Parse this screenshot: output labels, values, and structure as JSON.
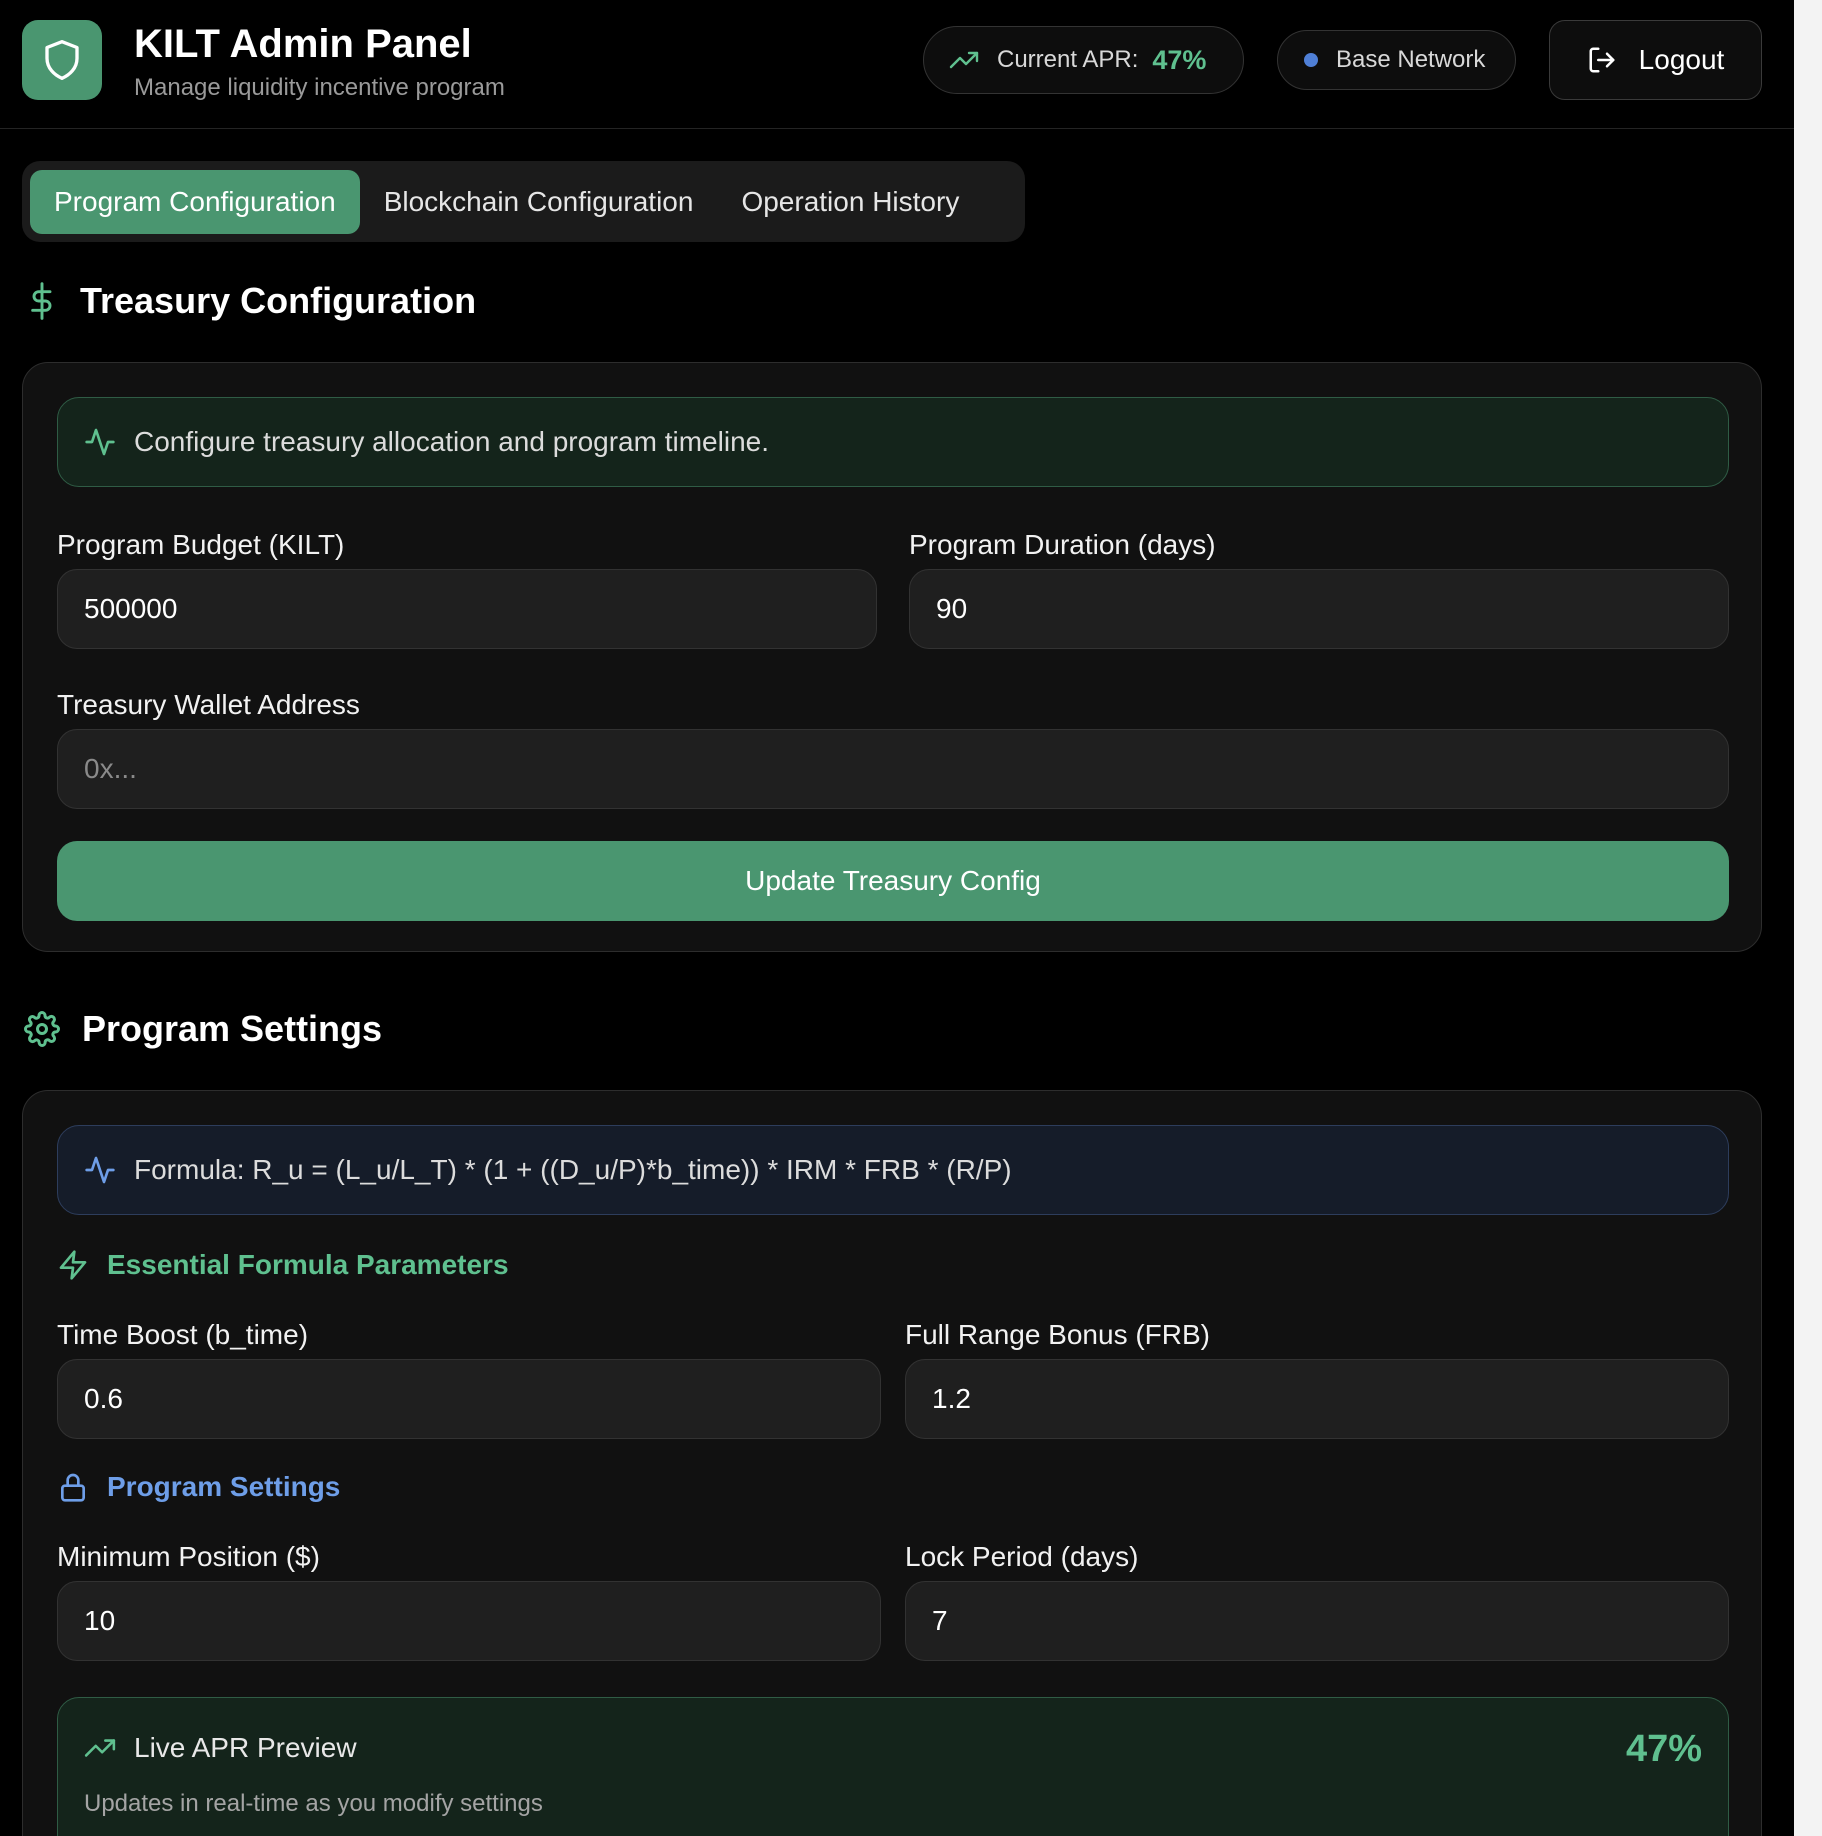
{
  "header": {
    "title": "KILT Admin Panel",
    "subtitle": "Manage liquidity incentive program",
    "apr_label": "Current APR:",
    "apr_value": "47%",
    "network_label": "Base Network",
    "logout_label": "Logout"
  },
  "tabs": [
    {
      "label": "Program Configuration",
      "active": true
    },
    {
      "label": "Blockchain Configuration",
      "active": false
    },
    {
      "label": "Operation History",
      "active": false
    }
  ],
  "treasury": {
    "title": "Treasury Configuration",
    "notice": "Configure treasury allocation and program timeline.",
    "budget_label": "Program Budget (KILT)",
    "budget_value": "500000",
    "duration_label": "Program Duration (days)",
    "duration_value": "90",
    "wallet_label": "Treasury Wallet Address",
    "wallet_placeholder": "0x...",
    "wallet_value": "",
    "update_button": "Update Treasury Config"
  },
  "settings": {
    "title": "Program Settings",
    "formula": "Formula: R_u = (L_u/L_T) * (1 + ((D_u/P)*b_time)) * IRM * FRB * (R/P)",
    "essential_title": "Essential Formula Parameters",
    "time_boost_label": "Time Boost (b_time)",
    "time_boost_value": "0.6",
    "frb_label": "Full Range Bonus (FRB)",
    "frb_value": "1.2",
    "program_settings_sub": "Program Settings",
    "min_position_label": "Minimum Position ($)",
    "min_position_value": "10",
    "lock_period_label": "Lock Period (days)",
    "lock_period_value": "7",
    "preview_title": "Live APR Preview",
    "preview_sub": "Updates in real-time as you modify settings",
    "preview_value": "47%"
  },
  "colors": {
    "accent": "#4a9670",
    "accent_text": "#5fc08f",
    "blue_accent": "#6e9ee8",
    "background": "#000000",
    "card": "#111111"
  },
  "icons": [
    "shield-icon",
    "trending-up-icon",
    "network-dot-icon",
    "logout-icon",
    "dollar-icon",
    "activity-icon",
    "gear-icon",
    "zap-icon",
    "lock-icon"
  ]
}
